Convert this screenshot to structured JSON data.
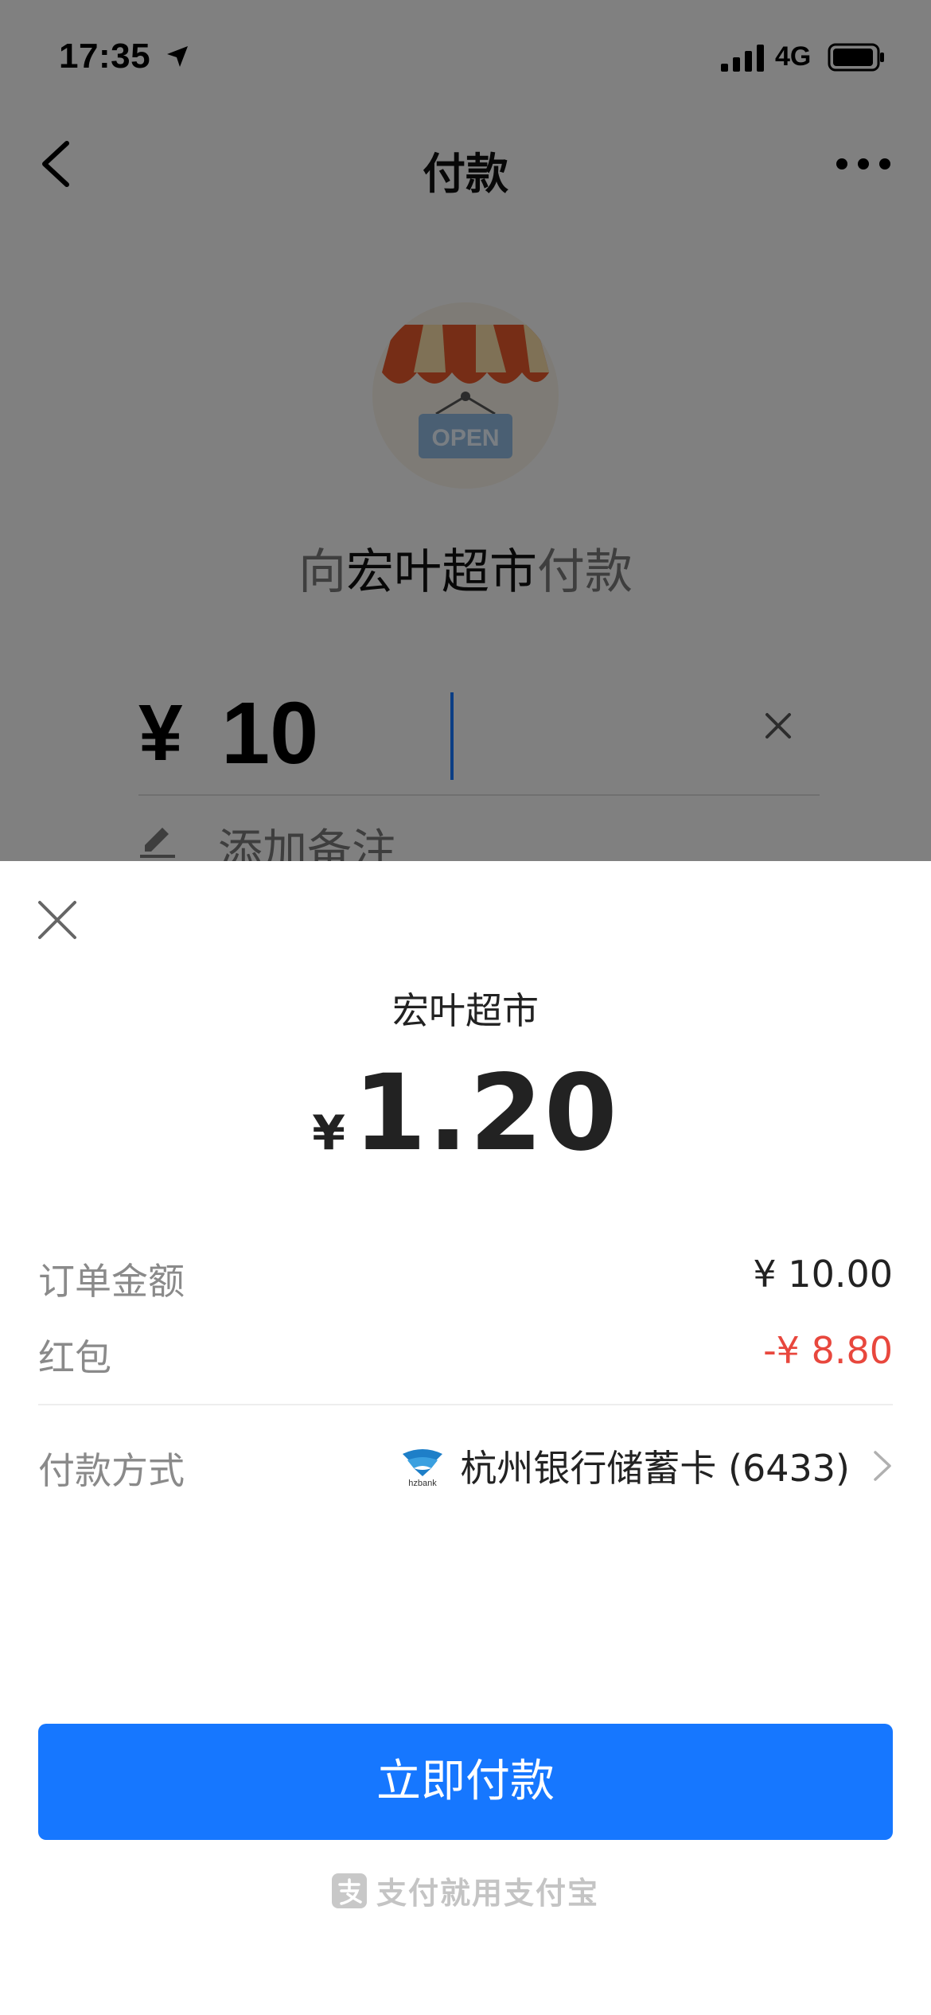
{
  "status_bar": {
    "time": "17:35",
    "network": "4G"
  },
  "nav": {
    "title": "付款"
  },
  "shop": {
    "logo_text": "OPEN",
    "pay_to_prefix": "向",
    "merchant": "宏叶超市",
    "pay_to_suffix": "付款"
  },
  "amount_input": {
    "currency": "¥",
    "value": "10"
  },
  "note": {
    "label": "添加备注"
  },
  "sheet": {
    "merchant": "宏叶超市",
    "currency": "¥",
    "amount": "1.20",
    "rows": [
      {
        "label": "订单金额",
        "value": "¥ 10.00"
      },
      {
        "label": "红包",
        "value": "-¥ 8.80"
      }
    ],
    "payment_method": {
      "label": "付款方式",
      "bank_icon_text": "hzbank",
      "value": "杭州银行储蓄卡 (6433)"
    },
    "pay_button": "立即付款",
    "footer": "支付就用支付宝"
  },
  "colors": {
    "primary": "#1677ff",
    "discount": "#e8473d",
    "awning_red": "#e2572b",
    "awning_cream": "#f3d9a6"
  }
}
